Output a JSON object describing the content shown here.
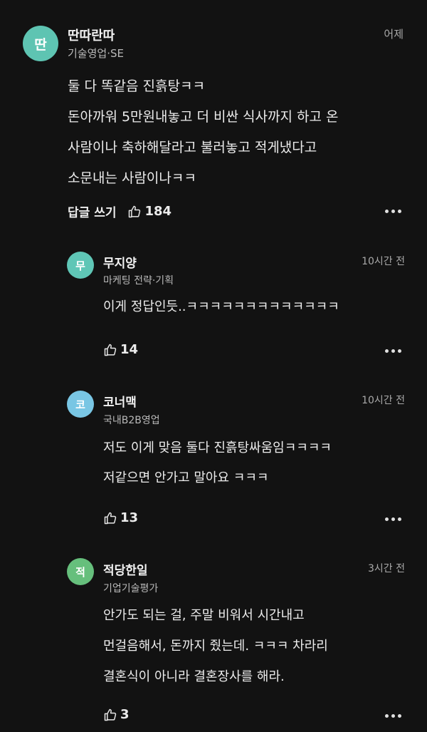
{
  "comments": [
    {
      "author": "딴따란따",
      "avatar_char": "딴",
      "avatar_color": "#5ec4b2",
      "role": "기술영업·SE",
      "time": "어제",
      "lines": [
        "둘 다 똑같음 진흙탕ㅋㅋ",
        "돈아까워 5만원내놓고 더 비싼 식사까지 하고 온",
        "사람이나 축하해달라고 불러놓고 적게냈다고",
        "소문내는 사람이나ㅋㅋ"
      ],
      "reply_label": "답글 쓰기",
      "likes": "184"
    },
    {
      "author": "무지양",
      "avatar_char": "무",
      "avatar_color": "#5fc6b6",
      "role": "마케팅 전략·기획",
      "time": "10시간 전",
      "lines": [
        "이게 정답인듯..ㅋㅋㅋㅋㅋㅋㅋㅋㅋㅋㅋㅋㅋ"
      ],
      "likes": "14"
    },
    {
      "author": "코너맥",
      "avatar_char": "코",
      "avatar_color": "#79c6e4",
      "role": "국내B2B영업",
      "time": "10시간 전",
      "lines": [
        "저도 이게 맞음 둘다 진흙탕싸움임ㅋㅋㅋㅋ",
        "저같으면 안가고 말아요 ㅋㅋㅋ"
      ],
      "likes": "13"
    },
    {
      "author": "적당한일",
      "avatar_char": "적",
      "avatar_color": "#66bf7c",
      "role": "기업기술평가",
      "time": "3시간 전",
      "lines": [
        "안가도 되는 걸, 주말 비워서 시간내고",
        "먼걸음해서, 돈까지 줬는데. ㅋㅋㅋ 차라리",
        "결혼식이 아니라 결혼장사를 해라."
      ],
      "likes": "3"
    }
  ]
}
